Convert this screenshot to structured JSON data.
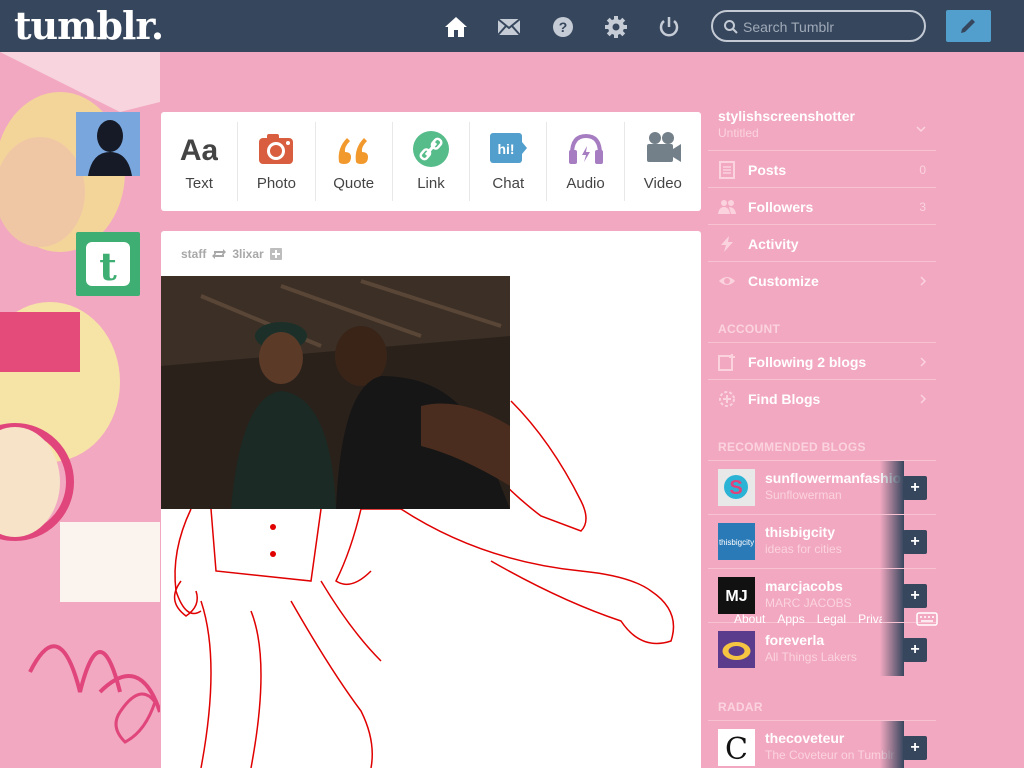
{
  "header": {
    "logo": "tumblr.",
    "search_placeholder": "Search Tumblr",
    "nav_icons": [
      "home-icon",
      "mail-icon",
      "help-icon",
      "settings-icon",
      "power-icon"
    ],
    "compose_icon": "pencil-icon"
  },
  "post_types": [
    {
      "label": "Text",
      "icon": "text-icon",
      "color": "#444444"
    },
    {
      "label": "Photo",
      "icon": "camera-icon",
      "color": "#d95e40"
    },
    {
      "label": "Quote",
      "icon": "quote-icon",
      "color": "#f2992e"
    },
    {
      "label": "Link",
      "icon": "link-icon",
      "color": "#56bc8a"
    },
    {
      "label": "Chat",
      "icon": "chat-icon",
      "color": "#529ecc"
    },
    {
      "label": "Audio",
      "icon": "headphones-icon",
      "color": "#a77dc2"
    },
    {
      "label": "Video",
      "icon": "video-camera-icon",
      "color": "#748089"
    }
  ],
  "post": {
    "author": "staff",
    "reblogged_from": "3lixar"
  },
  "sidebar": {
    "blog_name": "stylishscreenshotter",
    "blog_subtitle": "Untitled",
    "items": [
      {
        "label": "Posts",
        "count": "0",
        "icon": "posts-icon"
      },
      {
        "label": "Followers",
        "count": "3",
        "icon": "followers-icon"
      },
      {
        "label": "Activity",
        "count": "",
        "icon": "lightning-icon"
      },
      {
        "label": "Customize",
        "count": "",
        "icon": "eye-icon"
      }
    ],
    "account_heading": "ACCOUNT",
    "account_items": [
      {
        "label": "Following 2 blogs",
        "icon": "following-icon"
      },
      {
        "label": "Find Blogs",
        "icon": "find-blogs-icon"
      }
    ],
    "recommended_heading": "RECOMMENDED BLOGS",
    "recommended": [
      {
        "name": "sunflowermanfashion",
        "subtitle": "Sunflowerman",
        "avatar_color": "#e8e8e8"
      },
      {
        "name": "thisbigcity",
        "subtitle": "ideas for cities",
        "avatar_color": "#2a7ab8",
        "avatar_text": "thisbigcity"
      },
      {
        "name": "marcjacobs",
        "subtitle": "MARC JACOBS",
        "avatar_color": "#111111",
        "avatar_text": "MJ"
      },
      {
        "name": "foreverla",
        "subtitle": "All Things Lakers",
        "avatar_color": "#5a3b8c"
      }
    ],
    "footer_links": [
      "About",
      "Apps",
      "Legal",
      "Privacy"
    ],
    "radar_heading": "RADAR",
    "radar": {
      "name": "thecoveteur",
      "subtitle": "The Coveteur on Tumblr",
      "avatar_text": "C"
    }
  }
}
